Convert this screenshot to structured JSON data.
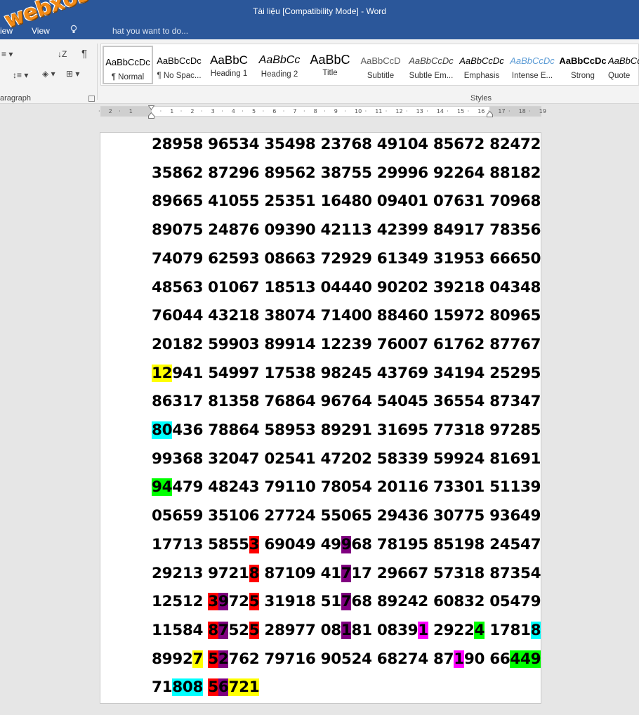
{
  "window": {
    "title": "Tài liệu [Compatibility Mode] - Word"
  },
  "tabs": {
    "review_partial": "iew",
    "view": "View",
    "tell_me": "hat you want to do..."
  },
  "ribbon": {
    "paragraph_label": "aragraph",
    "styles_label": "Styles",
    "styles": [
      {
        "preview": "AaBbCcDc",
        "label": "¶ Normal"
      },
      {
        "preview": "AaBbCcDc",
        "label": "¶ No Spac..."
      },
      {
        "preview": "AaBbC",
        "label": "Heading 1"
      },
      {
        "preview": "AaBbCc",
        "label": "Heading 2"
      },
      {
        "preview": "AaBbC",
        "label": "Title"
      },
      {
        "preview": "AaBbCcD",
        "label": "Subtitle"
      },
      {
        "preview": "AaBbCcDc",
        "label": "Subtle Em..."
      },
      {
        "preview": "AaBbCcDc",
        "label": "Emphasis"
      },
      {
        "preview": "AaBbCcDc",
        "label": "Intense E..."
      },
      {
        "preview": "AaBbCcDc",
        "label": "Strong"
      },
      {
        "preview": "AaBbCcDc",
        "label": "Quote"
      }
    ]
  },
  "ruler": {
    "ticks": [
      "2",
      "1",
      "1",
      "2",
      "3",
      "4",
      "5",
      "6",
      "7",
      "8",
      "9",
      "10",
      "11",
      "12",
      "13",
      "14",
      "15",
      "16",
      "17",
      "18",
      "19"
    ]
  },
  "watermark": "webxoso.net",
  "colors": {
    "yellow": "#ffff00",
    "cyan": "#00ffff",
    "green": "#00ff00",
    "red": "#ff0000",
    "purple": "#800080",
    "magenta": "#ff00ff"
  },
  "document": {
    "lines": [
      [
        {
          "t": "28958 96534 35498 23768 49104 85672 82472"
        }
      ],
      [
        {
          "t": "35862 87296 89562 38755 29996 92264 88182"
        }
      ],
      [
        {
          "t": "89665 41055 25351 16480 09401 07631 70968"
        }
      ],
      [
        {
          "t": "89075 24876 09390 42113 42399 84917 78356"
        }
      ],
      [
        {
          "t": "74079 62593 08663 72929 61349 31953 66650"
        }
      ],
      [
        {
          "t": "48563 01067 18513 04440 90202 39218 04348"
        }
      ],
      [
        {
          "t": "76044 43218 38074 71400 88460 15972 80965"
        }
      ],
      [
        {
          "t": "20182 59903 89914 12239 76007 61762 87767"
        }
      ],
      [
        {
          "t": "12",
          "h": "yellow"
        },
        {
          "t": "941 54997 17538 98245 43769 34194 25295"
        }
      ],
      [
        {
          "t": "86317 81358 76864 96764 54045 36554 87347"
        }
      ],
      [
        {
          "t": "80",
          "h": "cyan"
        },
        {
          "t": "436 78864 58953 89291 31695 77318 97285"
        }
      ],
      [
        {
          "t": "99368 32047 02541 47202 58339 59924 81691"
        }
      ],
      [
        {
          "t": "94",
          "h": "green"
        },
        {
          "t": "479 48243 79110 78054 20116 73301 51139"
        }
      ],
      [
        {
          "t": "05659 35106 27724 55065 29436 30775 93649"
        }
      ],
      [
        {
          "t": "17713 5855"
        },
        {
          "t": "3",
          "h": "red"
        },
        {
          "t": " 69049 49"
        },
        {
          "t": "9",
          "h": "purple"
        },
        {
          "t": "68 78195 85198 24547"
        }
      ],
      [
        {
          "t": "29213 9721"
        },
        {
          "t": "8",
          "h": "red"
        },
        {
          "t": " 87109 41"
        },
        {
          "t": "7",
          "h": "purple"
        },
        {
          "t": "17 29667 57318 87354"
        }
      ],
      [
        {
          "t": "12512 "
        },
        {
          "t": "3",
          "h": "red"
        },
        {
          "t": "9",
          "h": "purple"
        },
        {
          "t": "72"
        },
        {
          "t": "5",
          "h": "red"
        },
        {
          "t": " 31918 51"
        },
        {
          "t": "7",
          "h": "purple"
        },
        {
          "t": "68 89242 60832 05479"
        }
      ],
      [
        {
          "t": "11584 "
        },
        {
          "t": "8",
          "h": "red"
        },
        {
          "t": "7",
          "h": "purple"
        },
        {
          "t": "52"
        },
        {
          "t": "5",
          "h": "red"
        },
        {
          "t": " 28977 08"
        },
        {
          "t": "1",
          "h": "purple"
        },
        {
          "t": "81 0839"
        },
        {
          "t": "1",
          "h": "magenta"
        },
        {
          "t": " 2922"
        },
        {
          "t": "4",
          "h": "green"
        },
        {
          "t": " 1781"
        },
        {
          "t": "8",
          "h": "cyan"
        }
      ],
      [
        {
          "t": "8992"
        },
        {
          "t": "7",
          "h": "yellow"
        },
        {
          "t": " "
        },
        {
          "t": "5",
          "h": "red"
        },
        {
          "t": "2",
          "h": "purple"
        },
        {
          "t": "762 79716 90524 68274 87"
        },
        {
          "t": "1",
          "h": "magenta"
        },
        {
          "t": "90 66"
        },
        {
          "t": "449",
          "h": "green"
        }
      ],
      [
        {
          "t": "71"
        },
        {
          "t": "808",
          "h": "cyan"
        },
        {
          "t": " "
        },
        {
          "t": "5",
          "h": "red"
        },
        {
          "t": "6",
          "h": "purple"
        },
        {
          "t": "721",
          "h": "yellow"
        }
      ]
    ]
  }
}
